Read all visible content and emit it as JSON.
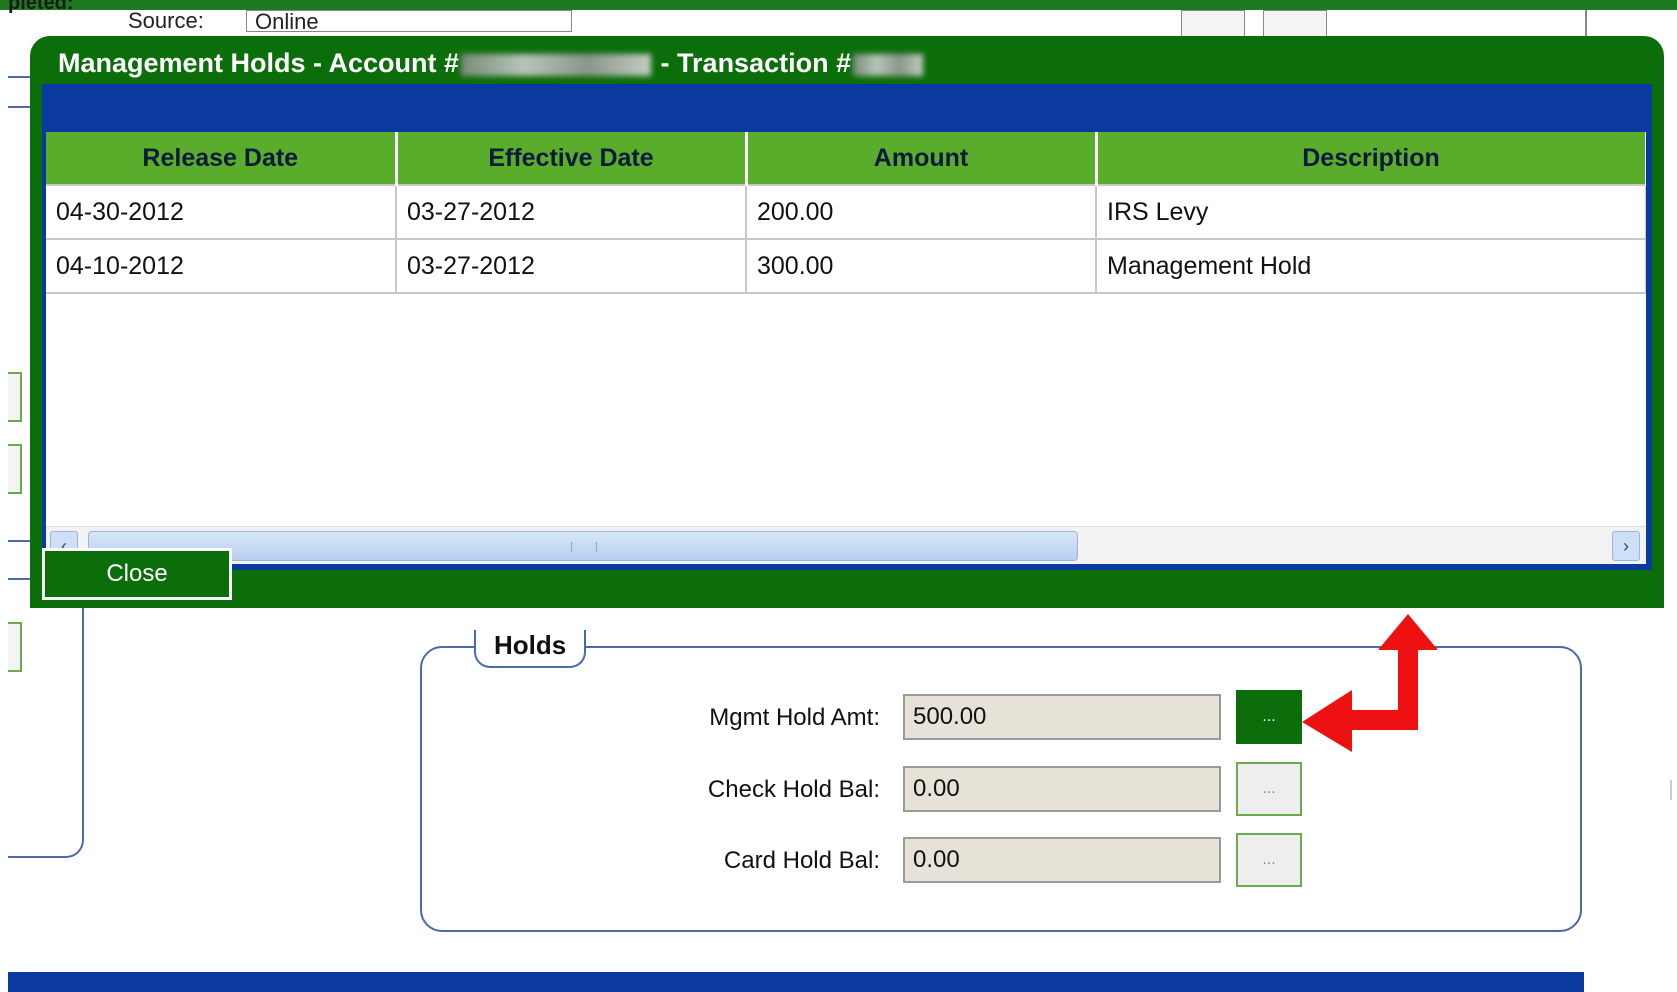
{
  "background": {
    "partial_heading": "pleted:",
    "source_label": "Source:",
    "source_value": "Online"
  },
  "modal": {
    "title_prefix": "Management Holds - Account #",
    "title_mid": " - Transaction #",
    "table": {
      "columns": [
        "Release Date",
        "Effective Date",
        "Amount",
        "Description"
      ],
      "rows": [
        [
          "04-30-2012",
          "03-27-2012",
          "200.00",
          "IRS Levy"
        ],
        [
          "04-10-2012",
          "03-27-2012",
          "300.00",
          "Management Hold"
        ]
      ]
    },
    "close_label": "Close"
  },
  "holds": {
    "legend": "Holds",
    "fields": [
      {
        "label": "Mgmt Hold Amt:",
        "value": "500.00",
        "button": "...",
        "active": true
      },
      {
        "label": "Check Hold Bal:",
        "value": "0.00",
        "button": "...",
        "active": false
      },
      {
        "label": "Card Hold Bal:",
        "value": "0.00",
        "button": "...",
        "active": false
      }
    ]
  },
  "icons": {
    "scroll_left": "chevron-left-icon",
    "scroll_right": "chevron-right-icon",
    "annotation": "red-arrow-icon"
  },
  "colors": {
    "modal_green": "#0b6e0b",
    "header_green": "#5aad2a",
    "blue_strip": "#0a3a9e",
    "annotation_red": "#ee1111"
  }
}
